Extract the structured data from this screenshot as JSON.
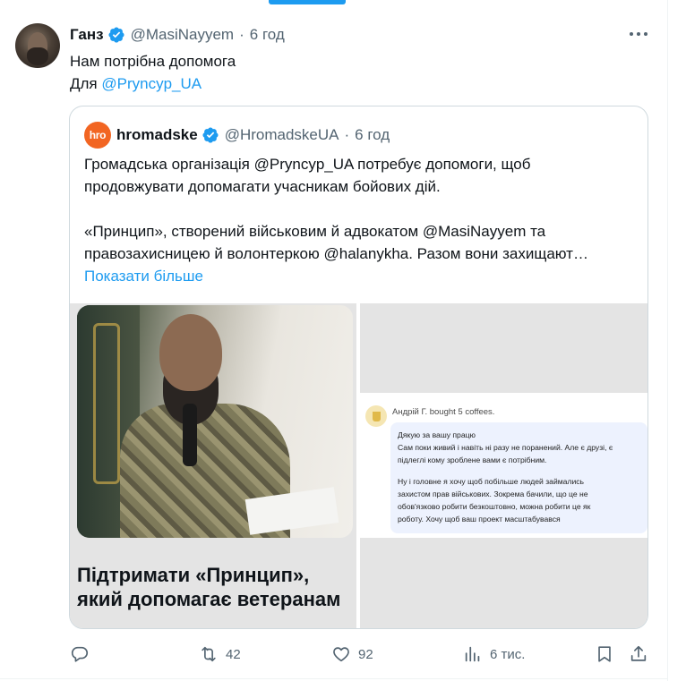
{
  "tweet": {
    "author_name": "Ганз",
    "author_handle": "@MasiNayyem",
    "time": "6 год",
    "separator": "·",
    "text_line1": "Нам потрібна допомога",
    "text_line2_prefix": "Для ",
    "text_line2_mention": "@Pryncyp_UA"
  },
  "quote": {
    "logo_text": "hro",
    "author_name": "hromadske",
    "author_handle": "@HromadskeUA",
    "time": "6 год",
    "separator": "·",
    "lines": [
      "Громадська організація @Pryncyp_UA потребує допомоги, щоб",
      "продовжувати допомагати учасникам бойових дій.",
      "«Принцип», створений військовим й адвокатом @MasiNayyem та",
      "правозахисницею й волонтеркою @halanykha. Разом вони захищают…"
    ],
    "show_more": "Показати більше"
  },
  "media": {
    "card_title_line1": "Підтримати «Принцип»,",
    "card_title_line2": "який допомагає ветеранам",
    "coffee_from": "Андрій Г. bought 5 coffees.",
    "bubble_lines": [
      "Дякую за вашу працю",
      "Сам поки живий і навіть ні разу не поранений. Але є друзі, є",
      "підлеглі кому зроблене вами є потрібним."
    ],
    "bubble_lines2": [
      "Ну і головне я хочу щоб побільше людей займались",
      "захистом прав військових. Зокрема бачили, що це не",
      "обов'язково робити безкоштовно, можна робити це як",
      "роботу. Хочу щоб ваш проект масштабувався"
    ]
  },
  "actions": {
    "reply_count": "",
    "retweet_count": "42",
    "like_count": "92",
    "views_count": "6 тис."
  },
  "colors": {
    "accent": "#1d9bf0",
    "secondary_text": "#536471",
    "border": "#cfd9de",
    "hromadske_logo": "#f26522"
  },
  "icons": [
    "verified-badge-icon",
    "more-icon",
    "reply-icon",
    "retweet-icon",
    "like-icon",
    "views-icon",
    "bookmark-icon",
    "share-icon"
  ]
}
